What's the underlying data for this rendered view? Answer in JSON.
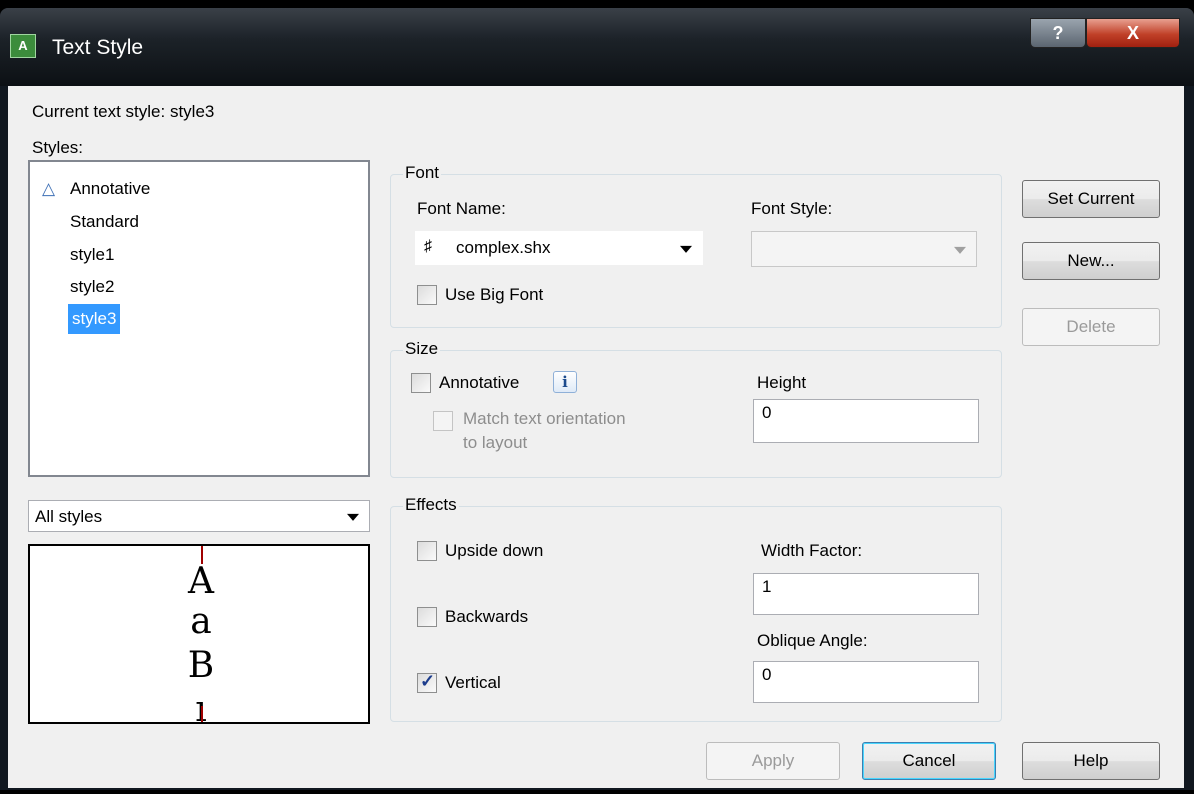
{
  "window": {
    "title": "Text Style",
    "app_icon": "autocad-style-icon",
    "help_button": "?",
    "close_button": "X"
  },
  "current_style": {
    "label": "Current text style:",
    "value": "style3"
  },
  "styles": {
    "label": "Styles:",
    "items": [
      {
        "label": "Annotative",
        "icon": "annotative-icon",
        "selected": false
      },
      {
        "label": "Standard",
        "selected": false
      },
      {
        "label": "style1",
        "selected": false
      },
      {
        "label": "style2",
        "selected": false
      },
      {
        "label": "style3",
        "selected": true
      }
    ],
    "filter": "All styles"
  },
  "preview": {
    "glyphs": [
      "A",
      "a",
      "B",
      "ı"
    ]
  },
  "font": {
    "group_label": "Font",
    "name_label": "Font Name:",
    "name_value": "complex.shx",
    "name_icon": "shx-font-icon",
    "style_label": "Font Style:",
    "style_value": "",
    "big_font_label": "Use Big Font",
    "big_font_checked": false
  },
  "size": {
    "group_label": "Size",
    "annotative_label": "Annotative",
    "annotative_checked": false,
    "info_icon": "i",
    "match_label_line1": "Match text orientation",
    "match_label_line2": "to layout",
    "match_checked": false,
    "height_label": "Height",
    "height_value": "0"
  },
  "effects": {
    "group_label": "Effects",
    "upside_down_label": "Upside down",
    "upside_down_checked": false,
    "backwards_label": "Backwards",
    "backwards_checked": false,
    "vertical_label": "Vertical",
    "vertical_checked": true,
    "width_factor_label": "Width Factor:",
    "width_factor_value": "1",
    "oblique_label": "Oblique Angle:",
    "oblique_value": "0"
  },
  "buttons": {
    "set_current": "Set Current",
    "new": "New...",
    "delete": "Delete",
    "apply": "Apply",
    "cancel": "Cancel",
    "help": "Help"
  },
  "colors": {
    "selection": "#3399ff",
    "close_button": "#c04028",
    "dialog_bg": "#f0f0f0"
  }
}
